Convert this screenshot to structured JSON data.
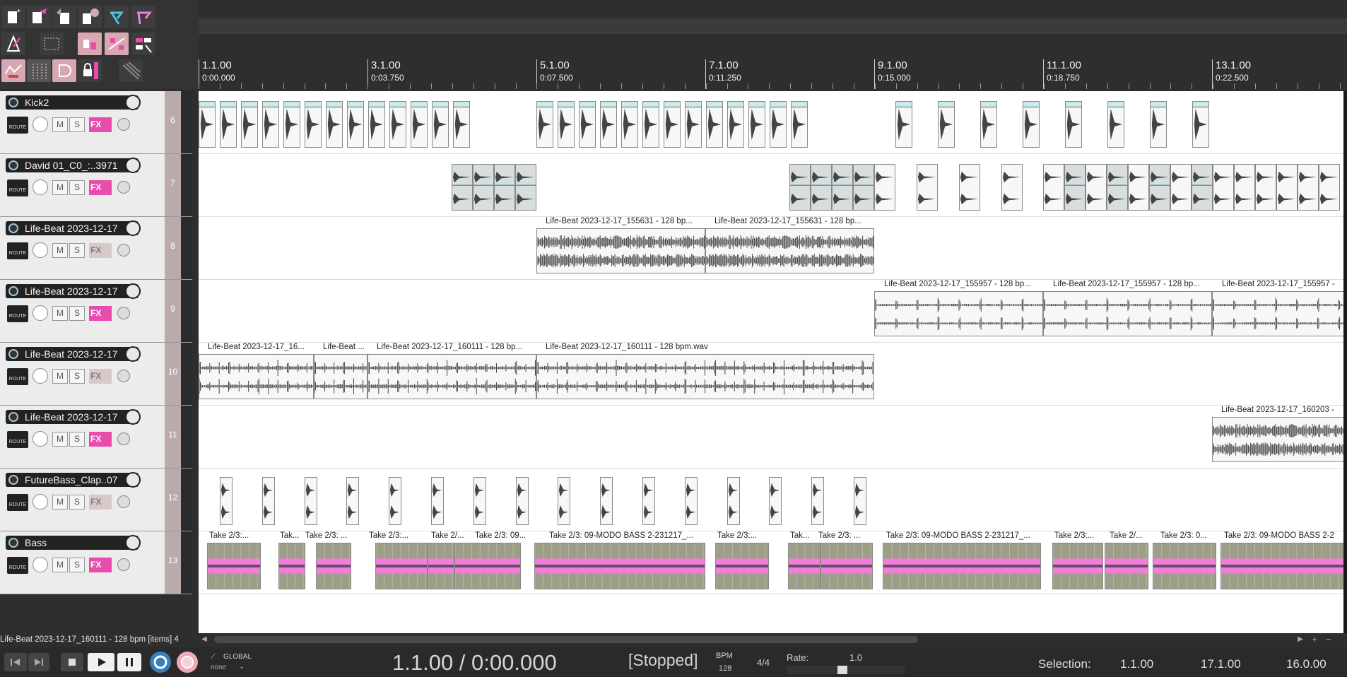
{
  "ruler": {
    "marks": [
      {
        "bar": "1.1.00",
        "time": "0:00.000"
      },
      {
        "bar": "3.1.00",
        "time": "0:03.750"
      },
      {
        "bar": "5.1.00",
        "time": "0:07.500"
      },
      {
        "bar": "7.1.00",
        "time": "0:11.250"
      },
      {
        "bar": "9.1.00",
        "time": "0:15.000"
      },
      {
        "bar": "11.1.00",
        "time": "0:18.750"
      },
      {
        "bar": "13.1.00",
        "time": "0:22.500"
      }
    ]
  },
  "tracks": [
    {
      "number": "6",
      "name": "Kick2",
      "fx_active": true,
      "fx_label": "FX",
      "mute": "M",
      "solo": "S",
      "route": "ROUTE"
    },
    {
      "number": "7",
      "name": "David 01_C0_:..3971",
      "fx_active": true,
      "fx_label": "FX",
      "mute": "M",
      "solo": "S",
      "route": "ROUTE"
    },
    {
      "number": "8",
      "name": "Life-Beat 2023-12-17",
      "fx_active": false,
      "fx_label": "FX",
      "mute": "M",
      "solo": "S",
      "route": "ROUTE"
    },
    {
      "number": "9",
      "name": "Life-Beat 2023-12-17",
      "fx_active": true,
      "fx_label": "FX",
      "mute": "M",
      "solo": "S",
      "route": "ROUTE"
    },
    {
      "number": "10",
      "name": "Life-Beat 2023-12-17",
      "fx_active": false,
      "fx_label": "FX",
      "mute": "M",
      "solo": "S",
      "route": "ROUTE"
    },
    {
      "number": "11",
      "name": "Life-Beat 2023-12-17",
      "fx_active": true,
      "fx_label": "FX",
      "mute": "M",
      "solo": "S",
      "route": "ROUTE"
    },
    {
      "number": "12",
      "name": "FutureBass_Clap..07",
      "fx_active": false,
      "fx_label": "FX",
      "mute": "M",
      "solo": "S",
      "route": "ROUTE"
    },
    {
      "number": "13",
      "name": "Bass",
      "fx_active": true,
      "fx_label": "FX",
      "mute": "M",
      "solo": "S",
      "route": "ROUTE"
    }
  ],
  "item_labels": {
    "t8_a": "Life-Beat 2023-12-17_155631 - 128 bp...",
    "t8_b": "Life-Beat 2023-12-17_155631 - 128 bp...",
    "t9_a": "Life-Beat 2023-12-17_155957 - 128 bp...",
    "t9_b": "Life-Beat 2023-12-17_155957 - 128 bp...",
    "t9_c": "Life-Beat 2023-12-17_155957 -",
    "t10_a": "Life-Beat 2023-12-17_16...",
    "t10_b": "Life-Beat ...",
    "t10_c": "Life-Beat 2023-12-17_160111 - 128 bp...",
    "t10_d": "Life-Beat 2023-12-17_160111 - 128 bpm.wav",
    "t11_a": "Life-Beat 2023-12-17_160203 -",
    "b1": "Take 2/3:...",
    "b2": "Tak...",
    "b3": "Take 2/3: ...",
    "b4": "Take 2/3:...",
    "b5": "Take 2/...",
    "b6": "Take 2/3: 09...",
    "b7": "Take 2/3: 09-MODO BASS 2-231217_...",
    "b8": "Take 2/3:...",
    "b9": "Tak...",
    "b10": "Take 2/3: ...",
    "b11": "Take 2/3: 09-MODO BASS 2-231217_...",
    "b12": "Take 2/3:...",
    "b13": "Take 2/...",
    "b14": "Take 2/3: 0...",
    "b15": "Take 2/3: 09-MODO BASS 2-2"
  },
  "status_item": "Life-Beat 2023-12-17_160111 - 128 bpm [items] 4",
  "transport": {
    "global_label": "GLOBAL",
    "none_label": "none",
    "position": "1.1.00 / 0:00.000",
    "state": "[Stopped]",
    "bpm_label": "BPM",
    "bpm_value": "128",
    "time_sig": "4/4",
    "rate_label": "Rate:",
    "rate_value": "1.0",
    "selection_label": "Selection:",
    "selection_start": "1.1.00",
    "selection_end": "17.1.00",
    "selection_length": "16.0.00"
  },
  "colors": {
    "fx_active": "#e84cad",
    "bass_item": "#9c9e88",
    "bass_band": "#f07fdc",
    "loop_button": "#3a7fb8"
  }
}
